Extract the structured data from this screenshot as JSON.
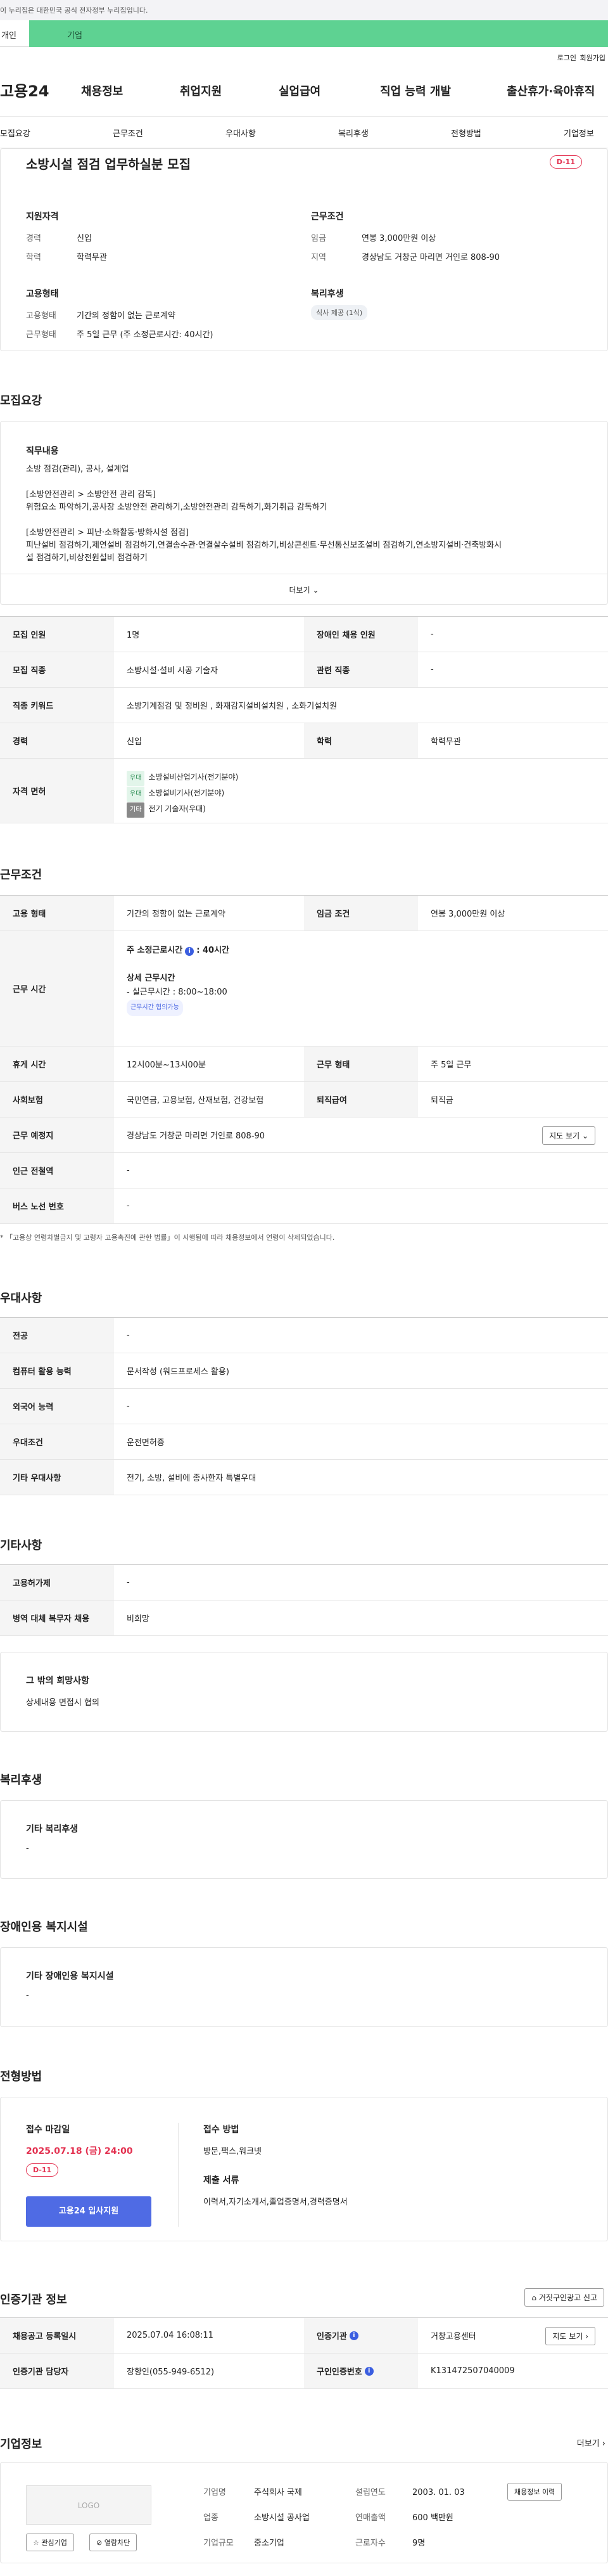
{
  "gov_banner": "이 누리집은 대한민국 공식 전자정부 누리집입니다.",
  "tabs": {
    "individual": "개인",
    "business": "기업"
  },
  "util": {
    "login": "로그인",
    "join": "회원가입"
  },
  "gnb": {
    "logo": "고용24",
    "menu": [
      "채용정보",
      "취업지원",
      "실업급여",
      "직업 능력 개발",
      "출산휴가·육아휴직"
    ]
  },
  "snb": [
    "모집요강",
    "근무조건",
    "우대사항",
    "복리후생",
    "전형방법",
    "기업정보"
  ],
  "job": {
    "title": "소방시설 점검 업무하실분 모집",
    "dday": "D-11"
  },
  "summary": {
    "qual_title": "지원자격",
    "career_k": "경력",
    "career_v": "신입",
    "edu_k": "학력",
    "edu_v": "학력무관",
    "cond_title": "근무조건",
    "wage_k": "임금",
    "wage_v": "연봉 3,000만원 이상",
    "loc_k": "지역",
    "loc_v": "경상남도 거창군 마리면 거인로 808-90",
    "emp_title": "고용형태",
    "etype_k": "고용형태",
    "etype_v": "기간의 정함이 없는 근로계약",
    "wtype_k": "근무형태",
    "wtype_v": "주 5일 근무 (주 소정근로시간: 40시간)",
    "welfare_title": "복리후생",
    "welfare_chip": "식사 제공 (1식)"
  },
  "recruit": {
    "title": "모집요강",
    "duty_title": "직무내용",
    "duty_lines": [
      "소방 점검(관리), 공사, 설계업",
      "[소방안전관리 > 소방안전 관리 감독]",
      "위험요소 파악하기,공사장 소방안전 관리하기,소방안전관리 감독하기,화기취급 감독하기",
      "[소방안전관리 > 피난·소화활동·방화시설 점검]",
      "피난설비 점검하기,제연설비 점검하기,연결송수관·연결살수설비 점검하기,비상콘센트·무선통신보조설비 점검하기,연소방지설비·건축방화시",
      "설 점검하기,비상전원설비 점검하기"
    ],
    "more": "더보기",
    "rows": [
      {
        "k1": "모집 인원",
        "v1": "1명",
        "k2": "장애인 채용 인원",
        "v2": "-"
      },
      {
        "k1": "모집 직종",
        "v1": "소방시설·설비 시공 기술자",
        "k2": "관련 직종",
        "v2": "-"
      },
      {
        "k1": "직종 키워드",
        "v1": "소방기계점검 및 정비원 , 화재감지설비설치원 , 소화기설치원"
      },
      {
        "k1": "경력",
        "v1": "신입",
        "k2": "학력",
        "v2": "학력무관"
      }
    ],
    "license_k": "자격 면허",
    "licenses": [
      {
        "tag": "우대",
        "name": "소방설비산업기사(전기분야)"
      },
      {
        "tag": "우대",
        "name": "소방설비기사(전기분야)"
      },
      {
        "tag": "기타",
        "name": "전기 기술자(우대)"
      }
    ]
  },
  "work": {
    "title": "근무조건",
    "etype_k": "고용 형태",
    "etype_v": "기간의 정함이 없는 근로계약",
    "wage_k": "임금 조건",
    "wage_v": "연봉 3,000만원 이상",
    "hours_k": "근무 시간",
    "hours_main": "주 소정근로시간",
    "hours_info": "i",
    "hours_val": ": 40시간",
    "hours_detail_t": "상세 근무시간",
    "hours_detail_v": "- 실근무시간 : 8:00~18:00",
    "hours_chip": "근무시간 협의가능",
    "rest_k": "휴게 시간",
    "rest_v": "12시00분~13시00분",
    "shift_k": "근무 형태",
    "shift_v": "주 5일 근무",
    "ins_k": "사회보험",
    "ins_v": "국민연금, 고용보험, 산재보험, 건강보험",
    "sev_k": "퇴직급여",
    "sev_v": "퇴직금",
    "place_k": "근무 예정지",
    "place_v": "경상남도 거창군 마리면 거인로 808-90",
    "map_btn": "지도 보기",
    "sub_k": "인근 전철역",
    "sub_v": "-",
    "bus_k": "버스 노선 번호",
    "bus_v": "-",
    "note": "* 「고용상 연령차별금지 및 고령자 고용촉진에 관한 법률」이 시행됨에 따라 채용정보에서 연령이 삭제되었습니다."
  },
  "pref": {
    "title": "우대사항",
    "rows": [
      {
        "k": "전공",
        "v": "-"
      },
      {
        "k": "컴퓨터 활용 능력",
        "v": "문서작성 (워드프로세스 활용)"
      },
      {
        "k": "외국어 능력",
        "v": "-"
      },
      {
        "k": "우대조건",
        "v": "운전면허증"
      },
      {
        "k": "기타 우대사항",
        "v": "전기, 소방, 설비에 종사한자 특별우대"
      }
    ]
  },
  "etc": {
    "title": "기타사항",
    "rows": [
      {
        "k": "고용허가제",
        "v": "-"
      },
      {
        "k": "병역 대체 복무자 채용",
        "v": "비희망"
      }
    ],
    "other_title": "그 밖의 희망사항",
    "other_v": "상세내용 면접시 협의"
  },
  "welfare": {
    "title": "복리후생",
    "box_t": "기타 복리후생",
    "box_v": "-"
  },
  "disab": {
    "title": "장애인용 복지시설",
    "box_t": "기타 장애인용 복지시설",
    "box_v": "-"
  },
  "select": {
    "title": "전형방법",
    "deadline_t": "접수 마감일",
    "deadline_v": "2025.07.18 (금) 24:00",
    "dday": "D-11",
    "apply": "고용24 입사지원",
    "method_t": "접수 방법",
    "method_v": "방문,팩스,워크넷",
    "docs_t": "제출 서류",
    "docs_v": "이력서,자기소개서,졸업증명서,경력증명서"
  },
  "agency": {
    "title": "인증기관 정보",
    "report_btn": "거짓구인광고 신고",
    "reg_k": "채용공고 등록일시",
    "reg_v": "2025.07.04 16:08:11",
    "ag_k": "인증기관",
    "ag_v": "거창고용센터",
    "map_btn": "지도 보기",
    "mgr_k": "인증기관 담당자",
    "mgr_v": "장향인(055-949-6512)",
    "no_k": "구인인증번호",
    "no_v": "K131472507040009"
  },
  "company": {
    "title": "기업정보",
    "more": "더보기",
    "logo": "LOGO",
    "fav": "관심기업",
    "block": "열람차단",
    "name_k": "기업명",
    "name_v": "주식회사 국제",
    "year_k": "설립연도",
    "year_v": "2003. 01. 03",
    "jobs_btn": "채용정보 이력",
    "ind_k": "업종",
    "ind_v": "소방시설 공사업",
    "sales_k": "연매출액",
    "sales_v": "600 백만원",
    "size_k": "기업규모",
    "size_v": "중소기업",
    "emp_k": "근로자수",
    "emp_v": "9명"
  }
}
